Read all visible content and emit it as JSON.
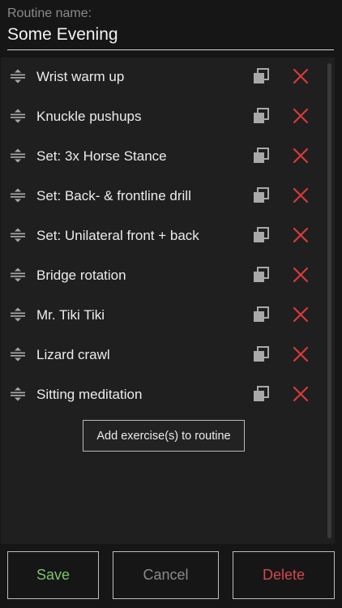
{
  "routine": {
    "label": "Routine name:",
    "name": "Some Evening"
  },
  "exercises": [
    {
      "label": "Wrist warm up"
    },
    {
      "label": "Knuckle pushups"
    },
    {
      "label": "Set: 3x Horse Stance"
    },
    {
      "label": "Set: Back- & frontline drill"
    },
    {
      "label": "Set: Unilateral front + back"
    },
    {
      "label": "Bridge rotation"
    },
    {
      "label": "Mr. Tiki Tiki"
    },
    {
      "label": "Lizard crawl"
    },
    {
      "label": "Sitting meditation"
    }
  ],
  "add_button": "Add exercise(s) to routine",
  "actions": {
    "save": "Save",
    "cancel": "Cancel",
    "delete": "Delete"
  },
  "colors": {
    "save": "#7cc36a",
    "delete_text": "#d1494d",
    "delete_icon": "#d83a3a",
    "background": "#161616"
  },
  "icons": {
    "drag": "drag-handle-icon",
    "copy": "copy-icon",
    "delete": "close-icon"
  }
}
